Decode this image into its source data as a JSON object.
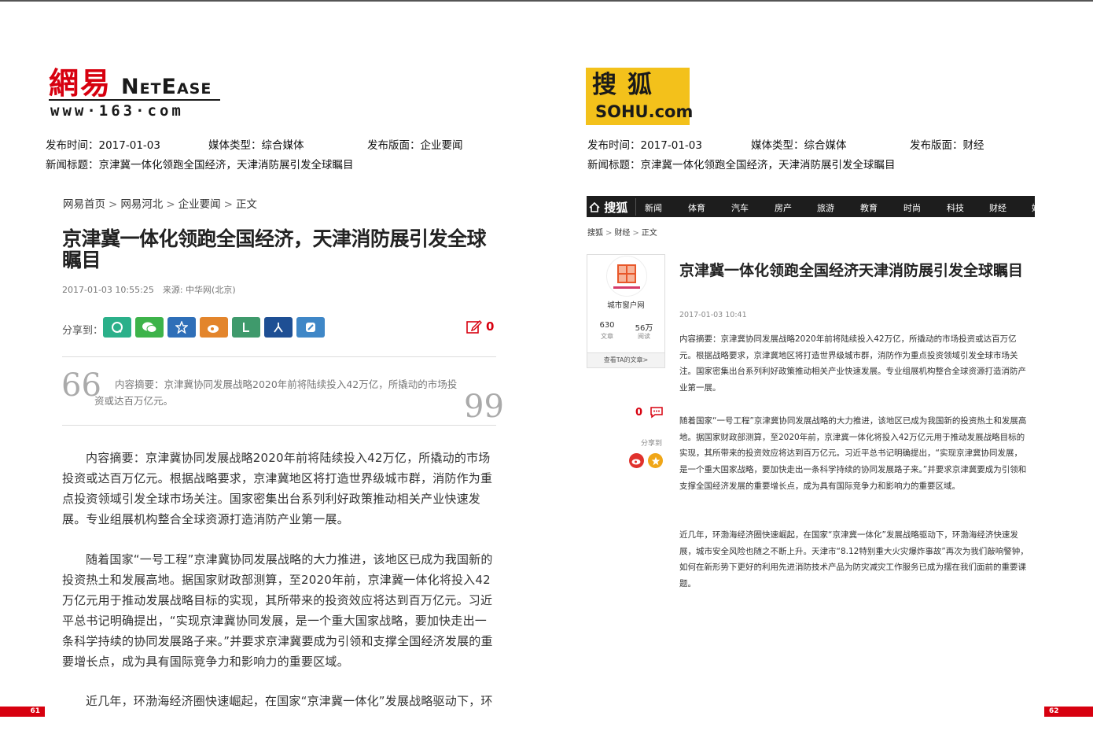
{
  "left": {
    "logo": {
      "cn": "網易",
      "en": "NetEase",
      "url": "www·163·com"
    },
    "meta": {
      "publish_time": "发布时间：2017-01-03",
      "media_type": "媒体类型：综合媒体",
      "section": "发布版面：企业要闻",
      "headline": "新闻标题：京津冀一体化领跑全国经济，天津消防展引发全球瞩目"
    },
    "breadcrumb": [
      "网易首页",
      "网易河北",
      "企业要闻",
      "正文"
    ],
    "breadcrumb_sep": ">",
    "title": "京津冀一体化领跑全国经济，天津消防展引发全球瞩目",
    "date_source": "2017-01-03 10:55:25　来源: 中华网(北京)",
    "share_label": "分享到：",
    "comment_count": "0",
    "quote_open": "66",
    "quote_close": "99",
    "summary": "内容摘要：京津冀协同发展战略2020年前将陆续投入42万亿，所撬动的市场投资或达百万亿元。",
    "paragraphs": [
      "内容摘要：京津冀协同发展战略2020年前将陆续投入42万亿，所撬动的市场投资或达百万亿元。根据战略要求，京津冀地区将打造世界级城市群，消防作为重点投资领域引发全球市场关注。国家密集出台系列利好政策推动相关产业快速发展。专业组展机构整合全球资源打造消防产业第一展。",
      "随着国家“一号工程”京津冀协同发展战略的大力推进，该地区已成为我国新的投资热土和发展高地。据国家财政部测算，至2020年前，京津冀一体化将投入42万亿元用于推动发展战略目标的实现，其所带来的投资效应将达到百万亿元。习近平总书记明确提出，“实现京津冀协同发展，是一个重大国家战略，要加快走出一条科学持续的协同发展路子来。”并要求京津冀要成为引领和支撑全国经济发展的重要增长点，成为具有国际竞争力和影响力的重要区域。",
      "近几年，环渤海经济圈快速崛起，在国家“京津冀一体化”发展战略驱动下，环"
    ],
    "page_number": "61"
  },
  "right": {
    "logo": {
      "cn": "搜狐",
      "en": "SOHU.com"
    },
    "meta": {
      "publish_time": "发布时间：2017-01-03",
      "media_type": "媒体类型：综合媒体",
      "section": "发布版面：财经",
      "headline": "新闻标题：京津冀一体化领跑全国经济，天津消防展引发全球瞩目"
    },
    "nav": {
      "logo": "搜狐",
      "items": [
        "新闻",
        "体育",
        "汽车",
        "房产",
        "旅游",
        "教育",
        "时尚",
        "科技",
        "财经",
        "娱"
      ]
    },
    "breadcrumb": [
      "搜狐",
      "财经",
      "正文"
    ],
    "breadcrumb_sep": ">",
    "profile": {
      "name": "城市窗户网",
      "articles": "630",
      "articles_label": "文章",
      "reads": "56万",
      "reads_label": "阅读",
      "foot": "查看TA的文章>"
    },
    "comment_count": "0",
    "share_label": "分享到",
    "title": "京津冀一体化领跑全国经济天津消防展引发全球瞩目",
    "date": "2017-01-03 10:41",
    "paragraphs": [
      "内容摘要：京津冀协同发展战略2020年前将陆续投入42万亿，所撬动的市场投资或达百万亿元。根据战略要求，京津冀地区将打造世界级城市群，消防作为重点投资领域引发全球市场关注。国家密集出台系列利好政策推动相关产业快速发展。专业组展机构整合全球资源打造消防产业第一展。",
      "随着国家“一号工程”京津冀协同发展战略的大力推进，该地区已成为我国新的投资热土和发展高地。据国家财政部测算，至2020年前，京津冀一体化将投入42万亿元用于推动发展战略目标的实现，其所带来的投资效应将达到百万亿元。习近平总书记明确提出，“实现京津冀协同发展，是一个重大国家战略，要加快走出一条科学持续的协同发展路子来。”并要求京津冀要成为引领和支撑全国经济发展的重要增长点，成为具有国际竞争力和影响力的重要区域。",
      "近几年，环渤海经济圈快速崛起，在国家“京津冀一体化”发展战略驱动下，环渤海经济快速发展，城市安全风险也随之不断上升。天津市“8.12特别重大火灾爆炸事故”再次为我们敲响警钟，如何在新形势下更好的利用先进消防技术产品为防灾减灾工作服务已成为摆在我们面前的重要课题。"
    ],
    "page_number": "62"
  },
  "colors": {
    "netease_red": "#d7000f",
    "sohu_yellow": "#f3c11b",
    "nav_bg": "#1d1d1d"
  }
}
